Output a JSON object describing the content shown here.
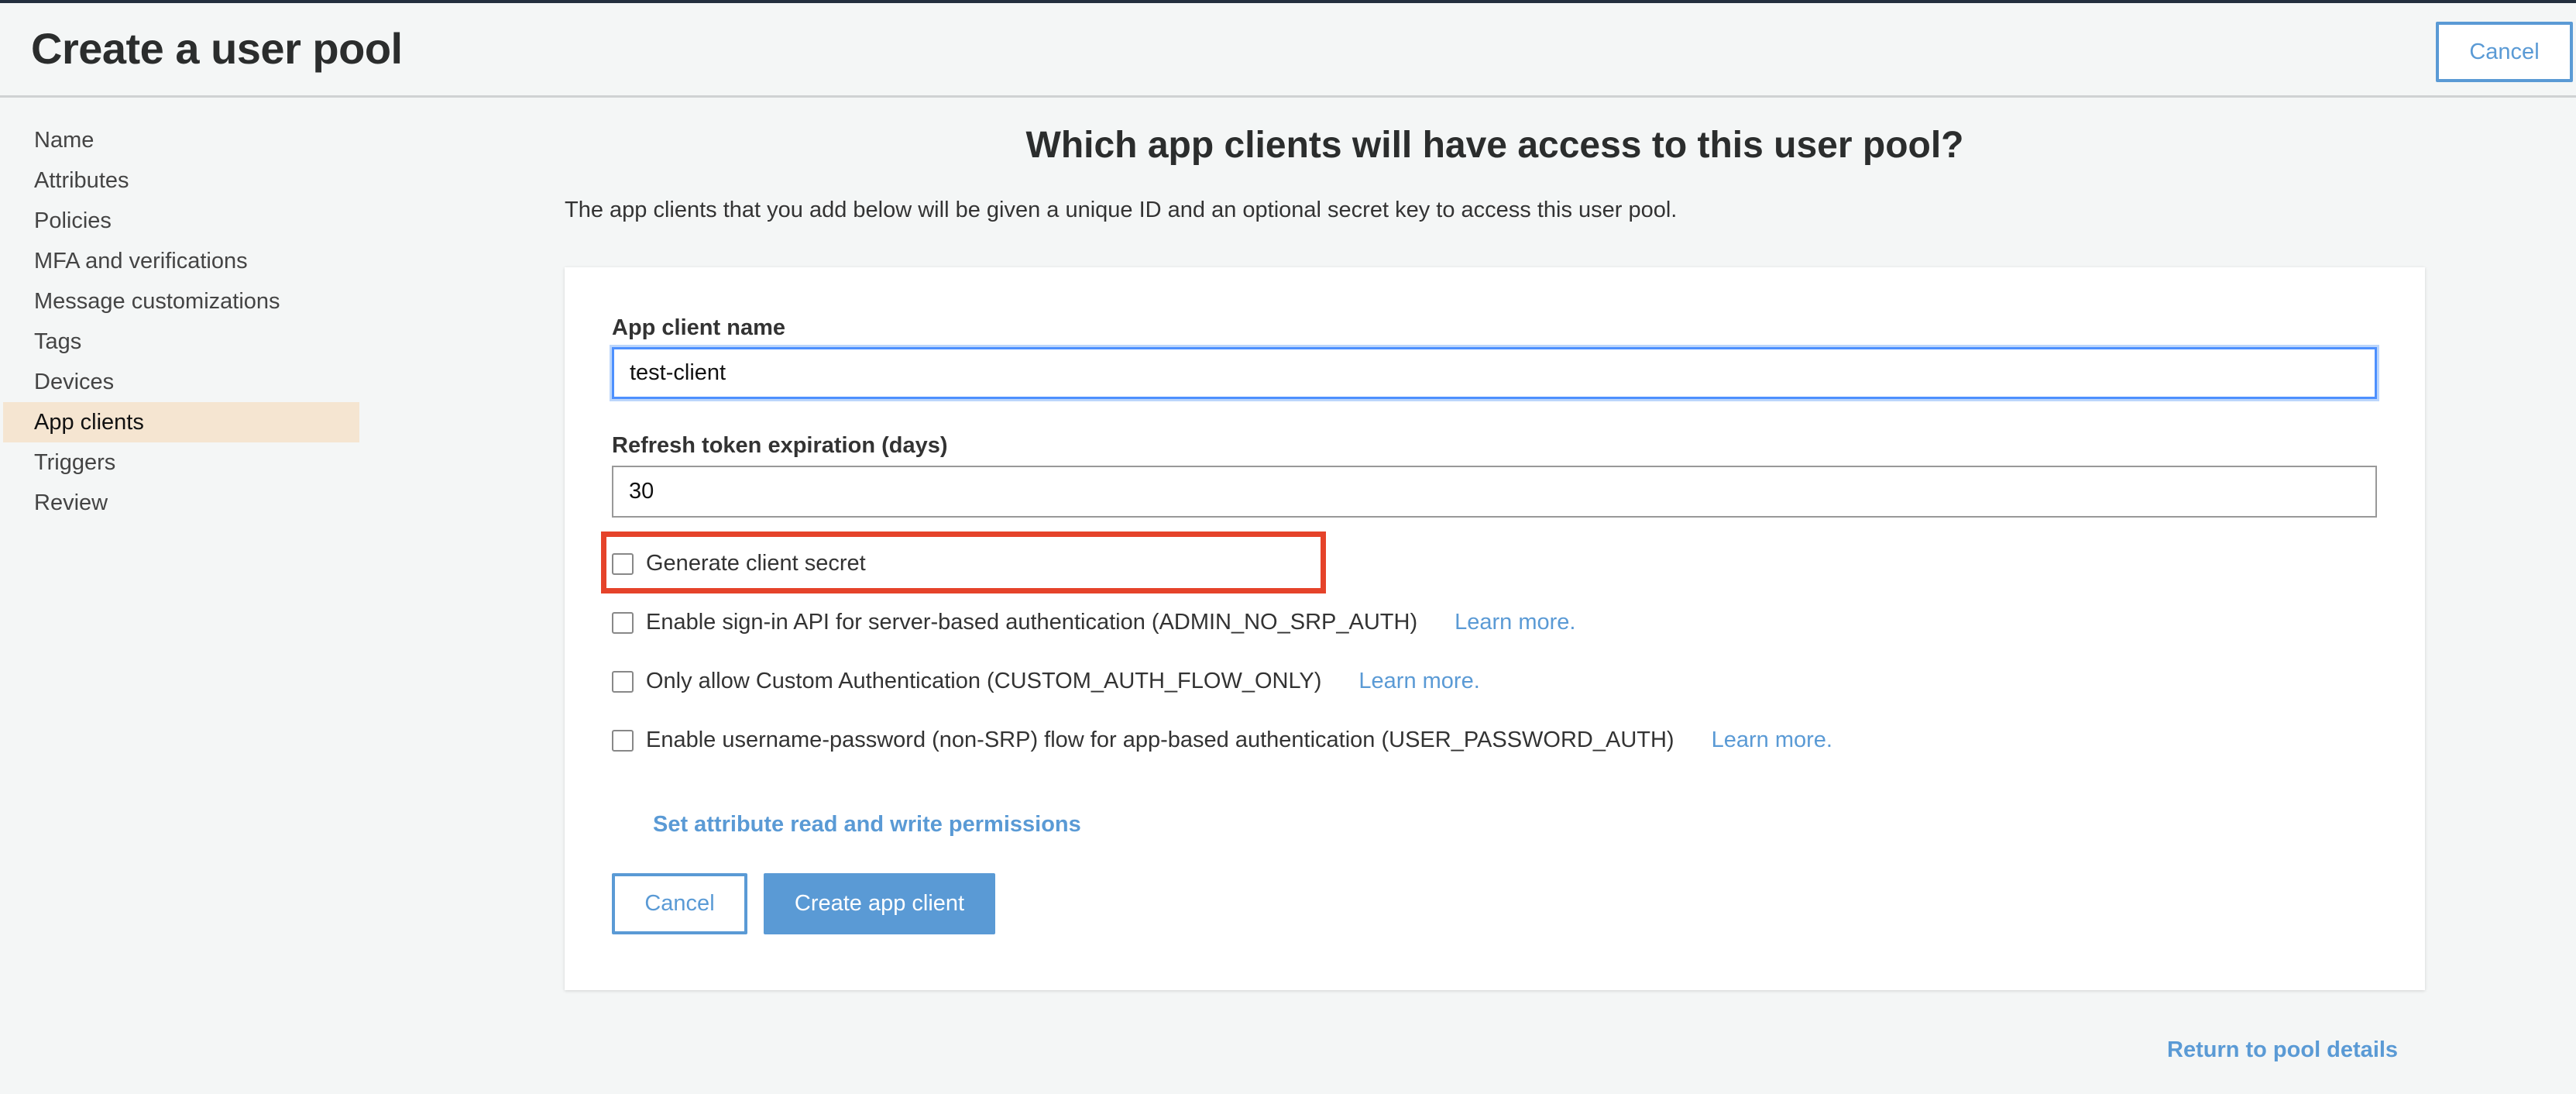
{
  "header": {
    "title": "Create a user pool",
    "cancel_label": "Cancel"
  },
  "sidebar": {
    "active_index": 7,
    "items": [
      {
        "label": "Name"
      },
      {
        "label": "Attributes"
      },
      {
        "label": "Policies"
      },
      {
        "label": "MFA and verifications"
      },
      {
        "label": "Message customizations"
      },
      {
        "label": "Tags"
      },
      {
        "label": "Devices"
      },
      {
        "label": "App clients"
      },
      {
        "label": "Triggers"
      },
      {
        "label": "Review"
      }
    ]
  },
  "main": {
    "heading": "Which app clients will have access to this user pool?",
    "description": "The app clients that you add below will be given a unique ID and an optional secret key to access this user pool.",
    "form": {
      "app_client_name": {
        "label": "App client name",
        "value": "test-client"
      },
      "refresh_token": {
        "label": "Refresh token expiration (days)",
        "value": "30"
      },
      "options": [
        {
          "label": "Generate client secret",
          "checked": false,
          "learn_more": null,
          "highlighted": true
        },
        {
          "label": "Enable sign-in API for server-based authentication (ADMIN_NO_SRP_AUTH)",
          "checked": false,
          "learn_more": "Learn more."
        },
        {
          "label": "Only allow Custom Authentication (CUSTOM_AUTH_FLOW_ONLY)",
          "checked": false,
          "learn_more": "Learn more."
        },
        {
          "label": "Enable username-password (non-SRP) flow for app-based authentication (USER_PASSWORD_AUTH)",
          "checked": false,
          "learn_more": "Learn more."
        }
      ],
      "permissions_link": "Set attribute read and write permissions",
      "cancel_label": "Cancel",
      "create_label": "Create app client"
    },
    "return_link": "Return to pool details"
  },
  "colors": {
    "accent": "#5a9ad5",
    "highlight_border": "#e5432a",
    "active_nav": "#f5e5d1",
    "background": "#f4f6f6",
    "topbar": "#232f3e"
  }
}
